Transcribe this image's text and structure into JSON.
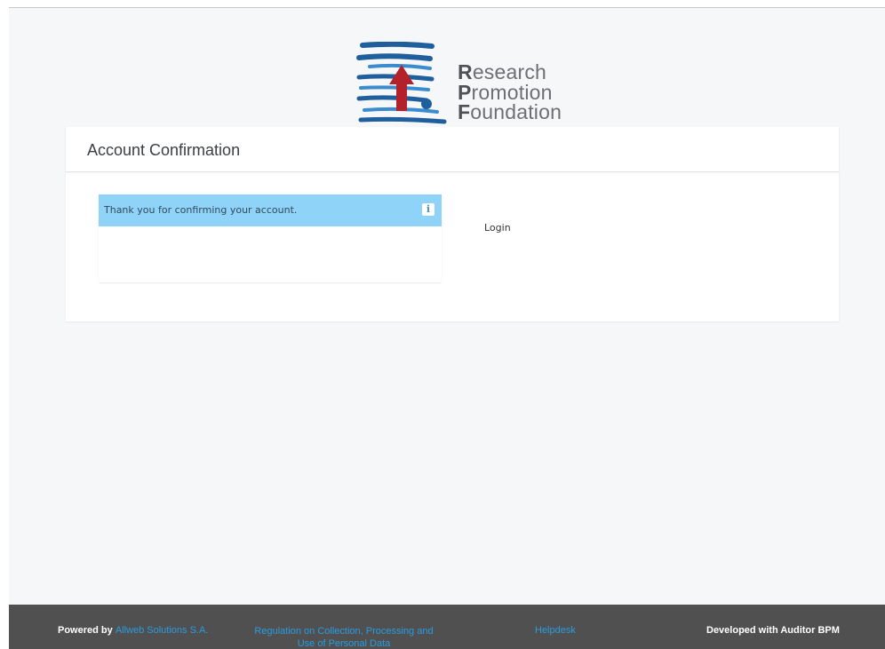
{
  "logo": {
    "line1_initial": "R",
    "line1_rest": "esearch",
    "line2_initial": "P",
    "line2_rest": "romotion",
    "line3_initial": "F",
    "line3_rest": "oundation",
    "colors": {
      "stripe": "#1f5f9e",
      "stripe_light": "#3a8ccf",
      "arrow": "#b3222b"
    }
  },
  "card": {
    "title": "Account Confirmation",
    "message": "Thank you for confirming your account.",
    "info_icon": "i",
    "login_label": "Login"
  },
  "footer": {
    "powered_prefix": "Powered by",
    "powered_company": "Allweb Solutions S.A.",
    "regulation_line1": "Regulation on Collection, Processing and",
    "regulation_line2": "Use of Personal Data",
    "helpdesk": "Helpdesk",
    "developed": "Developed with Auditor BPM"
  }
}
